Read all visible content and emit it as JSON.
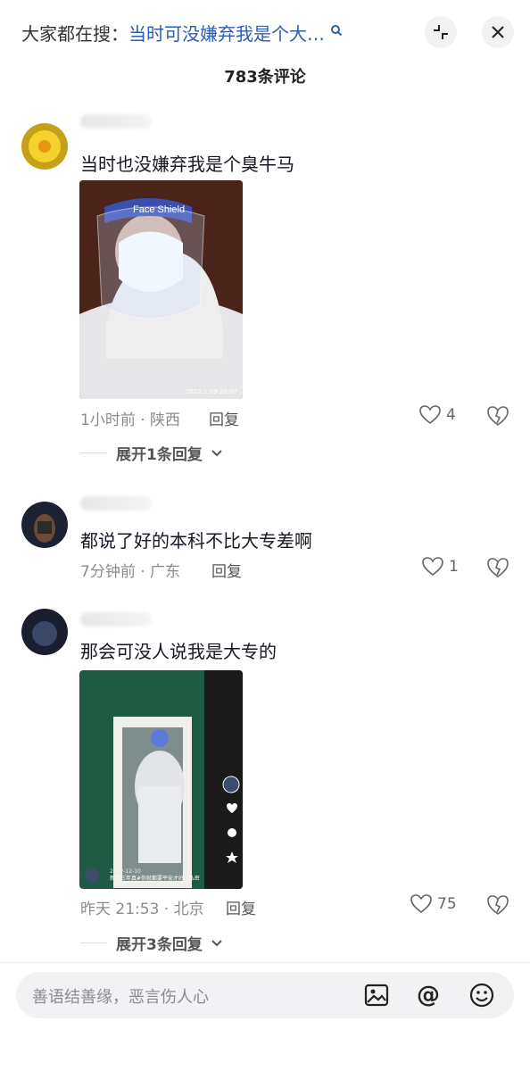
{
  "header": {
    "search_prefix": "大家都在搜：",
    "search_query": "当时可没嫌弃我是个大…",
    "search_icon": "search-icon",
    "collapse_icon": "collapse-icon",
    "close_icon": "close-icon"
  },
  "comment_count": "783条评论",
  "comments": [
    {
      "text": "当时也没嫌弃我是个臭牛马",
      "image_overlay": "2022.1.19 20:07",
      "time_location": "1小时前 · 陕西",
      "reply_label": "回复",
      "likes": "4",
      "expand_label": "展开1条回复"
    },
    {
      "text": "都说了好的本科不比大专差啊",
      "time_location": "7分钟前 · 广东",
      "reply_label": "回复",
      "likes": "1"
    },
    {
      "text": "那会可没人说我是大专的",
      "image_overlay": "新了三年真#你就都要平安才好 · 私密",
      "image_date": "2022-12-10",
      "time_location": "昨天 21:53 · 北京",
      "reply_label": "回复",
      "likes": "75",
      "expand_label": "展开3条回复"
    }
  ],
  "input": {
    "placeholder": "善语结善缘，恶言伤人心"
  },
  "colors": {
    "accent_query": "#2a5cb8",
    "meta_gray": "#8a8b91",
    "pill_bg": "#f2f2f4"
  }
}
